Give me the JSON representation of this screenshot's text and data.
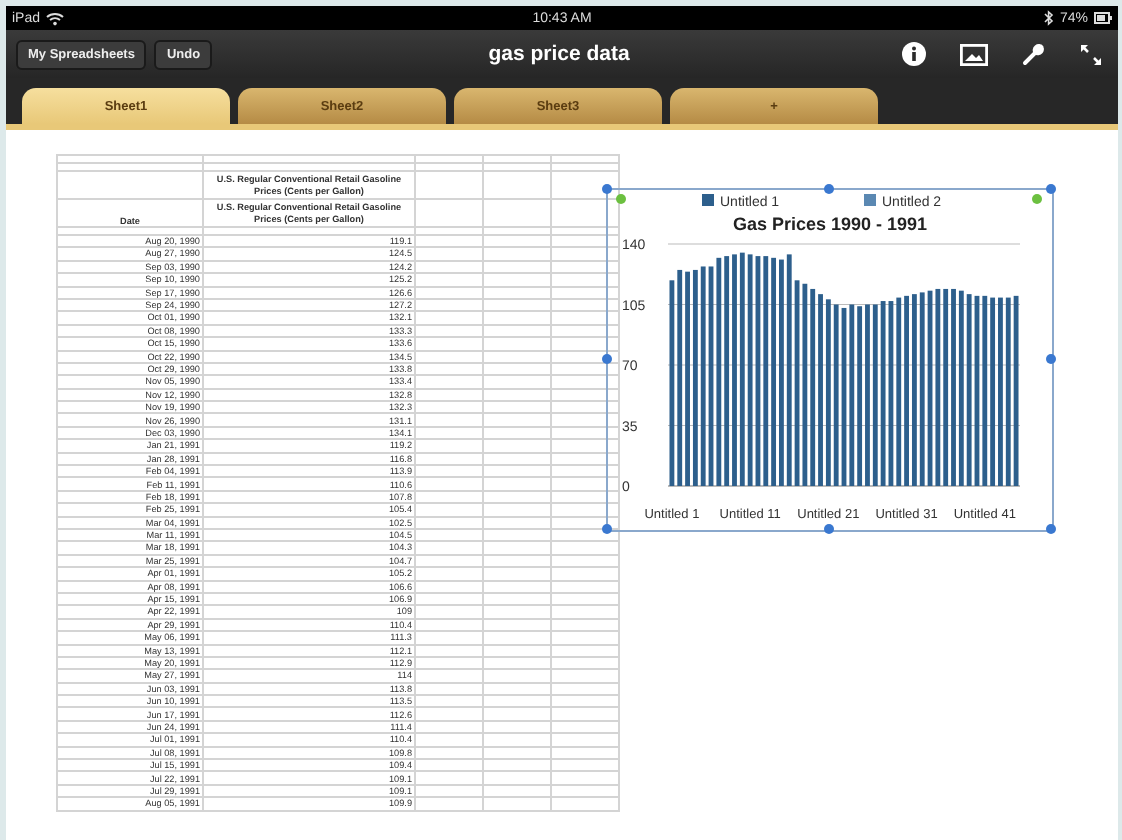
{
  "status_bar": {
    "device": "iPad",
    "time": "10:43 AM",
    "battery": "74%"
  },
  "toolbar": {
    "buttons": [
      "My Spreadsheets",
      "Undo"
    ],
    "title": "gas price data"
  },
  "tabs": [
    {
      "label": "Sheet1",
      "selected": true
    },
    {
      "label": "Sheet2",
      "selected": false
    },
    {
      "label": "Sheet3",
      "selected": false
    },
    {
      "label": "+",
      "selected": false
    }
  ],
  "table": {
    "header_date": "Date",
    "header_values": [
      "U.S. Regular Conventional Retail Gasoline Prices (Cents per Gallon)",
      "U.S. Regular Conventional Retail Gasoline Prices (Cents per Gallon)"
    ],
    "rows": [
      [
        "Aug 20, 1990",
        "119.1"
      ],
      [
        "Aug 27, 1990",
        "124.5"
      ],
      [
        "Sep 03, 1990",
        "124.2"
      ],
      [
        "Sep 10, 1990",
        "125.2"
      ],
      [
        "Sep 17, 1990",
        "126.6"
      ],
      [
        "Sep 24, 1990",
        "127.2"
      ],
      [
        "Oct 01, 1990",
        "132.1"
      ],
      [
        "Oct 08, 1990",
        "133.3"
      ],
      [
        "Oct 15, 1990",
        "133.6"
      ],
      [
        "Oct 22, 1990",
        "134.5"
      ],
      [
        "Oct 29, 1990",
        "133.8"
      ],
      [
        "Nov 05, 1990",
        "133.4"
      ],
      [
        "Nov 12, 1990",
        "132.8"
      ],
      [
        "Nov 19, 1990",
        "132.3"
      ],
      [
        "Nov 26, 1990",
        "131.1"
      ],
      [
        "Dec 03, 1990",
        "134.1"
      ],
      [
        "Jan 21, 1991",
        "119.2"
      ],
      [
        "Jan 28, 1991",
        "116.8"
      ],
      [
        "Feb 04, 1991",
        "113.9"
      ],
      [
        "Feb 11, 1991",
        "110.6"
      ],
      [
        "Feb 18, 1991",
        "107.8"
      ],
      [
        "Feb 25, 1991",
        "105.4"
      ],
      [
        "Mar 04, 1991",
        "102.5"
      ],
      [
        "Mar 11, 1991",
        "104.5"
      ],
      [
        "Mar 18, 1991",
        "104.3"
      ],
      [
        "Mar 25, 1991",
        "104.7"
      ],
      [
        "Apr 01, 1991",
        "105.2"
      ],
      [
        "Apr 08, 1991",
        "106.6"
      ],
      [
        "Apr 15, 1991",
        "106.9"
      ],
      [
        "Apr 22, 1991",
        "109"
      ],
      [
        "Apr 29, 1991",
        "110.4"
      ],
      [
        "May 06, 1991",
        "111.3"
      ],
      [
        "May 13, 1991",
        "112.1"
      ],
      [
        "May 20, 1991",
        "112.9"
      ],
      [
        "May 27, 1991",
        "114"
      ],
      [
        "Jun 03, 1991",
        "113.8"
      ],
      [
        "Jun 10, 1991",
        "113.5"
      ],
      [
        "Jun 17, 1991",
        "112.6"
      ],
      [
        "Jun 24, 1991",
        "111.4"
      ],
      [
        "Jul 01, 1991",
        "110.4"
      ],
      [
        "Jul 08, 1991",
        "109.8"
      ],
      [
        "Jul 15, 1991",
        "109.4"
      ],
      [
        "Jul 22, 1991",
        "109.1"
      ],
      [
        "Jul 29, 1991",
        "109.1"
      ],
      [
        "Aug 05, 1991",
        "109.9"
      ]
    ]
  },
  "chart": {
    "chart_data": {
      "type": "bar",
      "title": "Gas Prices 1990 - 1991",
      "categories": [
        "Untitled 1",
        null,
        null,
        null,
        null,
        null,
        null,
        null,
        null,
        null,
        "Untitled 11",
        null,
        null,
        null,
        null,
        null,
        null,
        null,
        null,
        null,
        "Untitled 21",
        null,
        null,
        null,
        null,
        null,
        null,
        null,
        null,
        null,
        "Untitled 31",
        null,
        null,
        null,
        null,
        null,
        null,
        null,
        null,
        null,
        "Untitled 41",
        null,
        null,
        null,
        null
      ],
      "ylim": [
        0,
        140
      ],
      "yticks": [
        0,
        35,
        70,
        105,
        140
      ],
      "grid": true,
      "series": [
        {
          "name": "Untitled 1",
          "color": "#2d5f8c",
          "values": [
            119,
            125,
            124,
            125,
            127,
            127,
            132,
            133,
            134,
            135,
            134,
            133,
            133,
            132,
            131,
            134,
            119,
            117,
            114,
            111,
            108,
            105,
            103,
            105,
            104,
            105,
            105,
            107,
            107,
            109,
            110,
            111,
            112,
            113,
            114,
            114,
            114,
            113,
            111,
            110,
            110,
            109,
            109,
            109,
            110
          ]
        }
      ]
    },
    "extra_legend": [
      {
        "name": "Untitled 2",
        "color": "#5a88b2"
      }
    ]
  }
}
